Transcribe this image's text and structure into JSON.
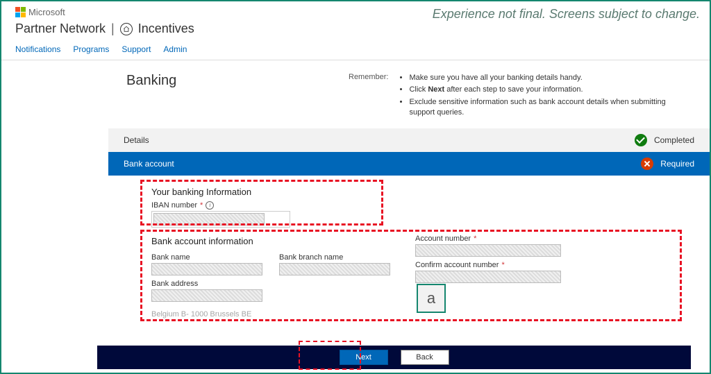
{
  "header": {
    "microsoft_label": "Microsoft",
    "partner_network": "Partner Network",
    "incentives": "Incentives",
    "nav": [
      "Notifications",
      "Programs",
      "Support",
      "Admin"
    ]
  },
  "disclaimer": "Experience not final. Screens subject to change.",
  "page": {
    "title": "Banking",
    "remember_label": "Remember:",
    "remember_items": [
      "Make sure you have all your banking details handy.",
      "Click Next after each step to save your information.",
      "Exclude sensitive information such as bank account details when submitting support queries."
    ]
  },
  "sections": {
    "details": {
      "label": "Details",
      "status": "Completed"
    },
    "bank_account": {
      "label": "Bank account",
      "status": "Required"
    }
  },
  "form": {
    "heading1": "Your banking Information",
    "iban_label": "IBAN number ",
    "heading2": "Bank account information",
    "bank_name_label": "Bank name",
    "bank_branch_label": "Bank branch name",
    "bank_address_label": "Bank address",
    "account_number_label": "Account number ",
    "confirm_account_label": "Confirm account number ",
    "country_line": "Belgium  B- 1000 Brussels BE"
  },
  "footer": {
    "next": "Next",
    "back": "Back"
  },
  "annotation": {
    "a": "a"
  }
}
